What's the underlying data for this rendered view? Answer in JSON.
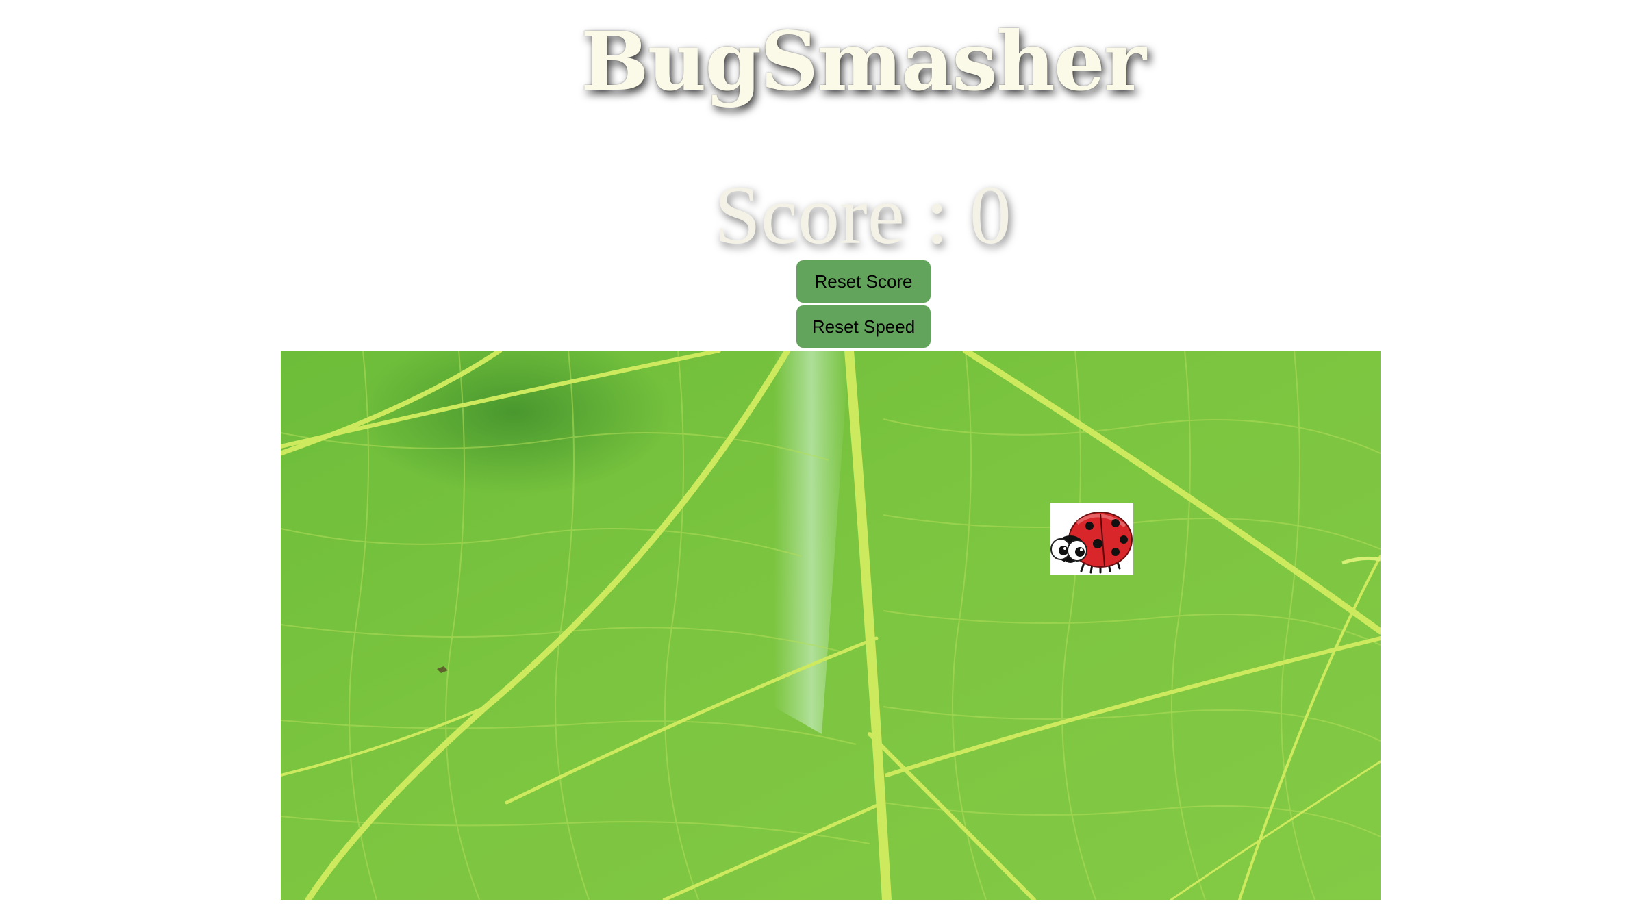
{
  "game": {
    "title": "BugSmasher",
    "score_label": "Score : ",
    "score_value": "0",
    "buttons": {
      "reset_score": "Reset Score",
      "reset_speed": "Reset Speed"
    },
    "board": {
      "background": "leaf-texture"
    },
    "bug": {
      "icon": "ladybug-icon"
    }
  },
  "colors": {
    "title_text": "#fbf9e8",
    "button_bg": "#63a45c",
    "leaf_green": "#7cc540",
    "leaf_vein": "#c7e85a",
    "ladybug_red": "#d8262b"
  }
}
